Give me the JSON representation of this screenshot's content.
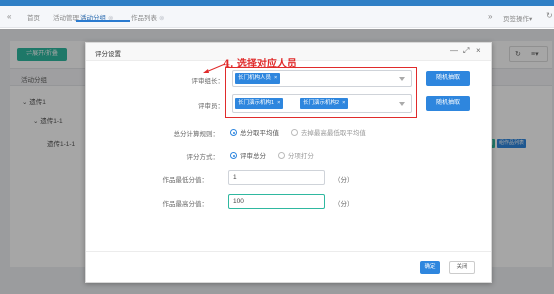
{
  "tabs": {
    "prev_icon": "double-chevron-left-icon",
    "items": [
      {
        "label": "首页",
        "closable": false
      },
      {
        "label": "活动管理",
        "closable": true
      },
      {
        "label": "活动分组",
        "closable": true,
        "active": true
      },
      {
        "label": "作品列表",
        "closable": true
      }
    ],
    "close_glyph": "⊗",
    "next_icon": "double-chevron-right-icon",
    "page_ops": "页签操作",
    "page_ops_caret": "▾",
    "refresh_icon": "refresh-icon"
  },
  "background": {
    "expand_label": "⇌展开/折叠",
    "column_header": "活动分组",
    "tree": [
      "⌄ 遗传1",
      "⌄ 遗传1-1",
      "遗传1-1-1"
    ],
    "row_buttons": [
      "组",
      "组作品列表"
    ],
    "toolbar_icons": [
      "refresh-icon",
      "menu-icon"
    ]
  },
  "dialog": {
    "title": "评分设置",
    "controls": {
      "minimize": "—",
      "maximize": "⤢",
      "close": "×"
    },
    "annotation": "4. 选择对应人员",
    "fields": {
      "leader_label": "评审组长：",
      "leader_chips": [
        "长门机构人员"
      ],
      "members_label": "评审员：",
      "members_chips": [
        "长门演示机构1",
        "长门演示机构2"
      ],
      "chip_remove": "×",
      "random_button": "随机抽取",
      "calc_label": "总分计算规则：",
      "calc_options": [
        "总分取平均值",
        "去掉最高最低取平均值"
      ],
      "method_label": "评分方式：",
      "method_options": [
        "评审总分",
        "分项打分"
      ],
      "min_label": "作品最低分值：",
      "min_value": "1",
      "max_label": "作品最高分值：",
      "max_value": "100",
      "unit": "（分）"
    },
    "buttons": {
      "ok": "确定",
      "close": "关闭"
    }
  },
  "colors": {
    "primary": "#2e86de",
    "annotation_red": "#e02b2b",
    "teal": "#2fb8a0"
  }
}
